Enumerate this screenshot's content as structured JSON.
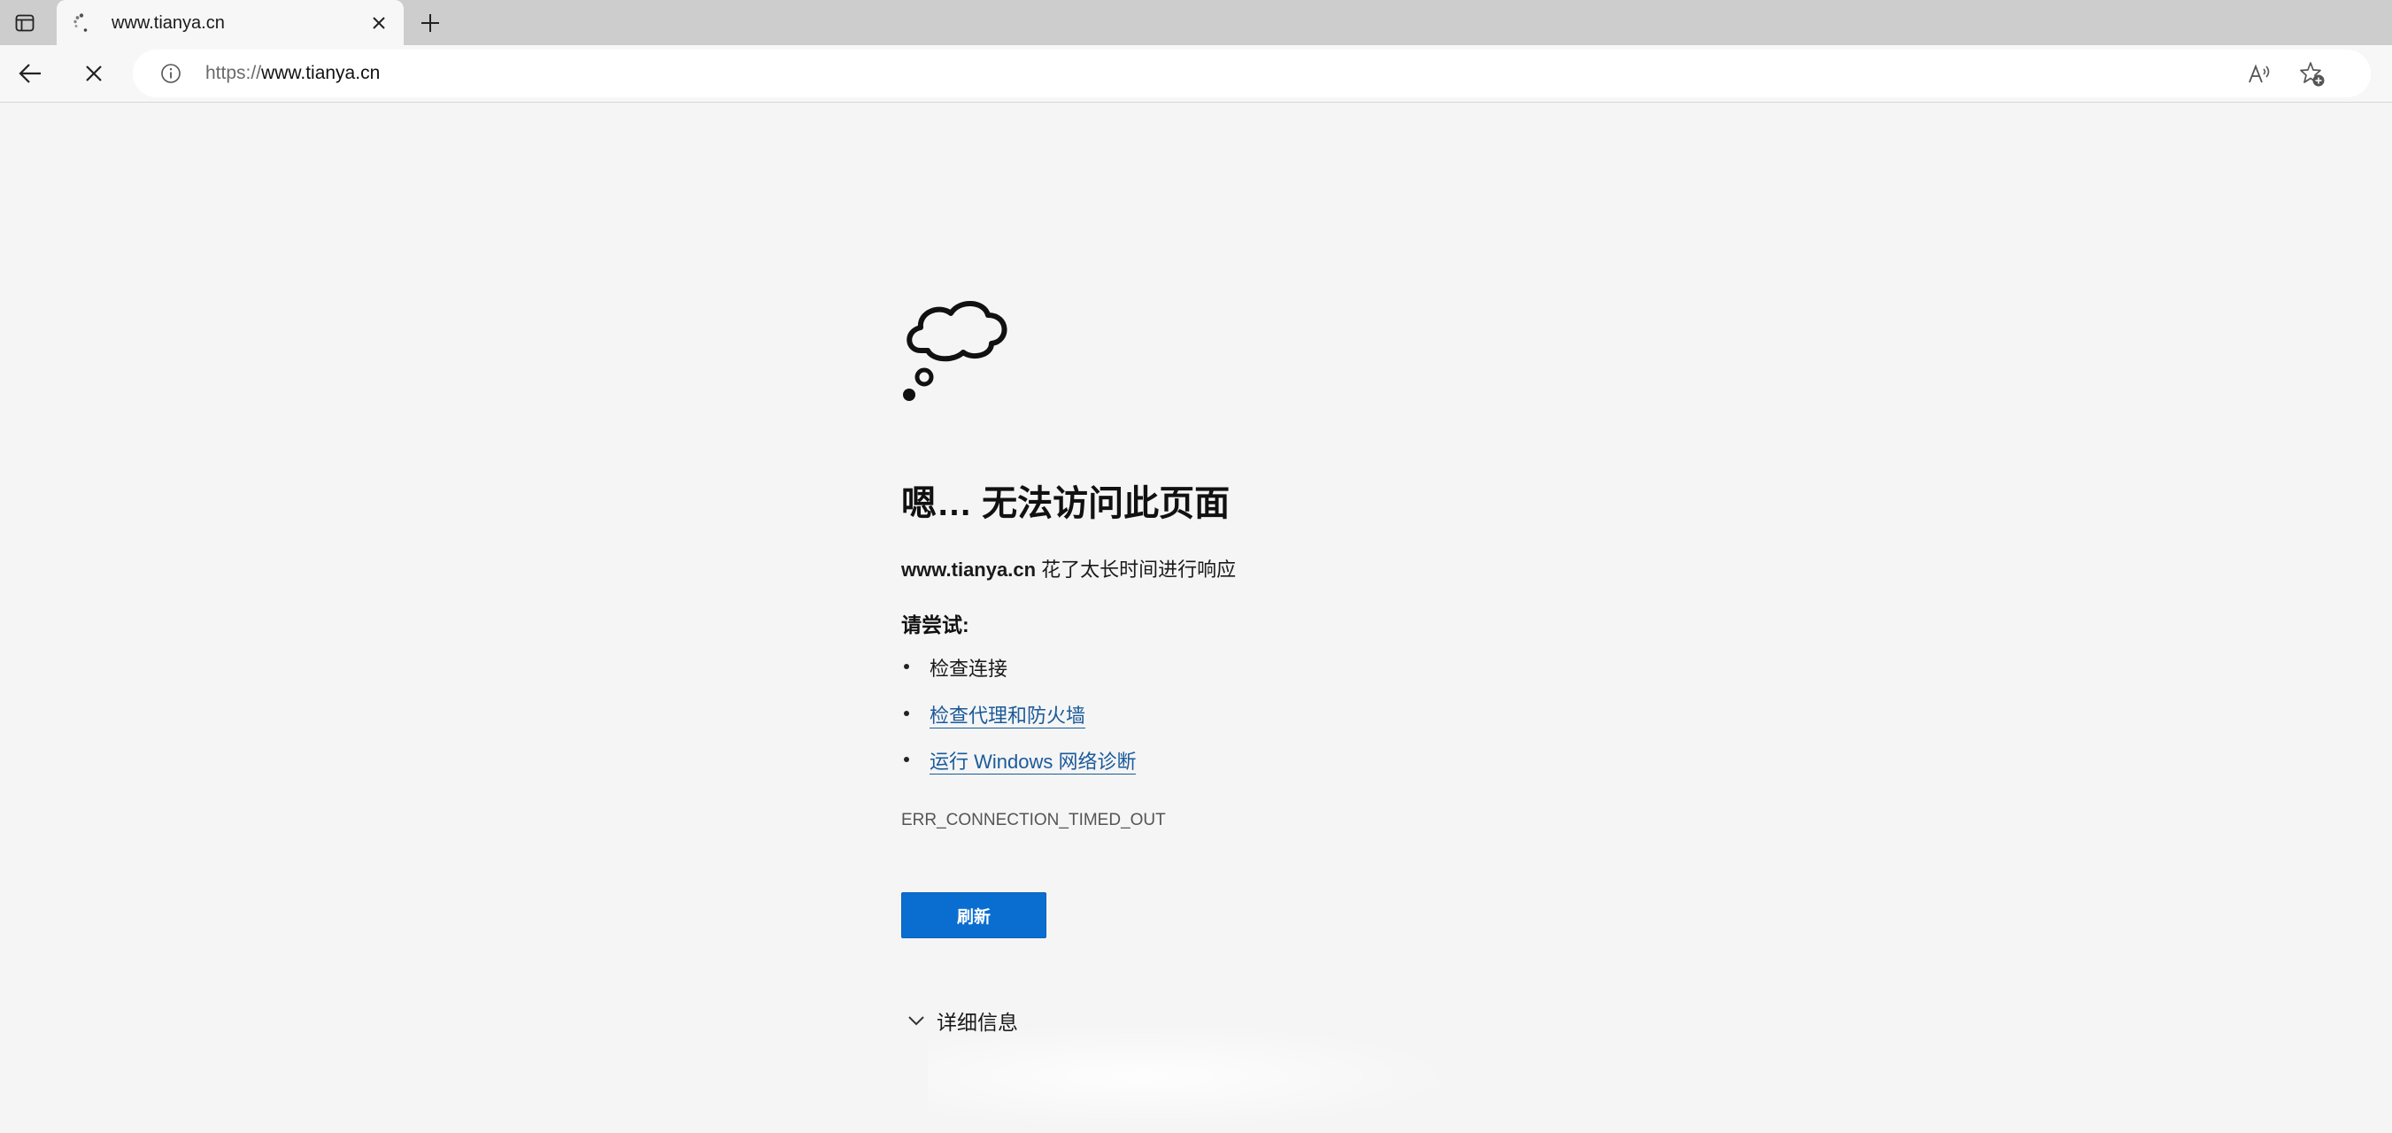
{
  "browser": {
    "tab": {
      "title": "www.tianya.cn"
    },
    "address_bar": {
      "scheme": "https://",
      "host": "www.tianya.cn"
    }
  },
  "error_page": {
    "headline": "嗯… 无法访问此页面",
    "host": "www.tianya.cn",
    "message": " 花了太长时间进行响应",
    "try_label": "请尝试:",
    "suggestions": [
      {
        "text": "检查连接",
        "link": false
      },
      {
        "text": "检查代理和防火墙",
        "link": true
      },
      {
        "text": "运行 Windows 网络诊断",
        "link": true
      }
    ],
    "error_code": "ERR_CONNECTION_TIMED_OUT",
    "refresh_label": "刷新",
    "details_label": "详细信息"
  },
  "icons": {
    "tab_actions": "tab-actions-icon",
    "loading": "loading-spinner-icon",
    "close": "close-icon",
    "new_tab": "plus-icon",
    "back": "back-arrow-icon",
    "stop": "stop-icon",
    "site_info": "info-icon",
    "read_aloud": "read-aloud-icon",
    "favorites": "add-favorite-icon",
    "error": "thought-cloud-icon",
    "details": "chevron-down-icon"
  },
  "colors": {
    "accent": "#0a6ed1",
    "link": "#1a5a9a",
    "page_background": "#f5f5f5"
  }
}
